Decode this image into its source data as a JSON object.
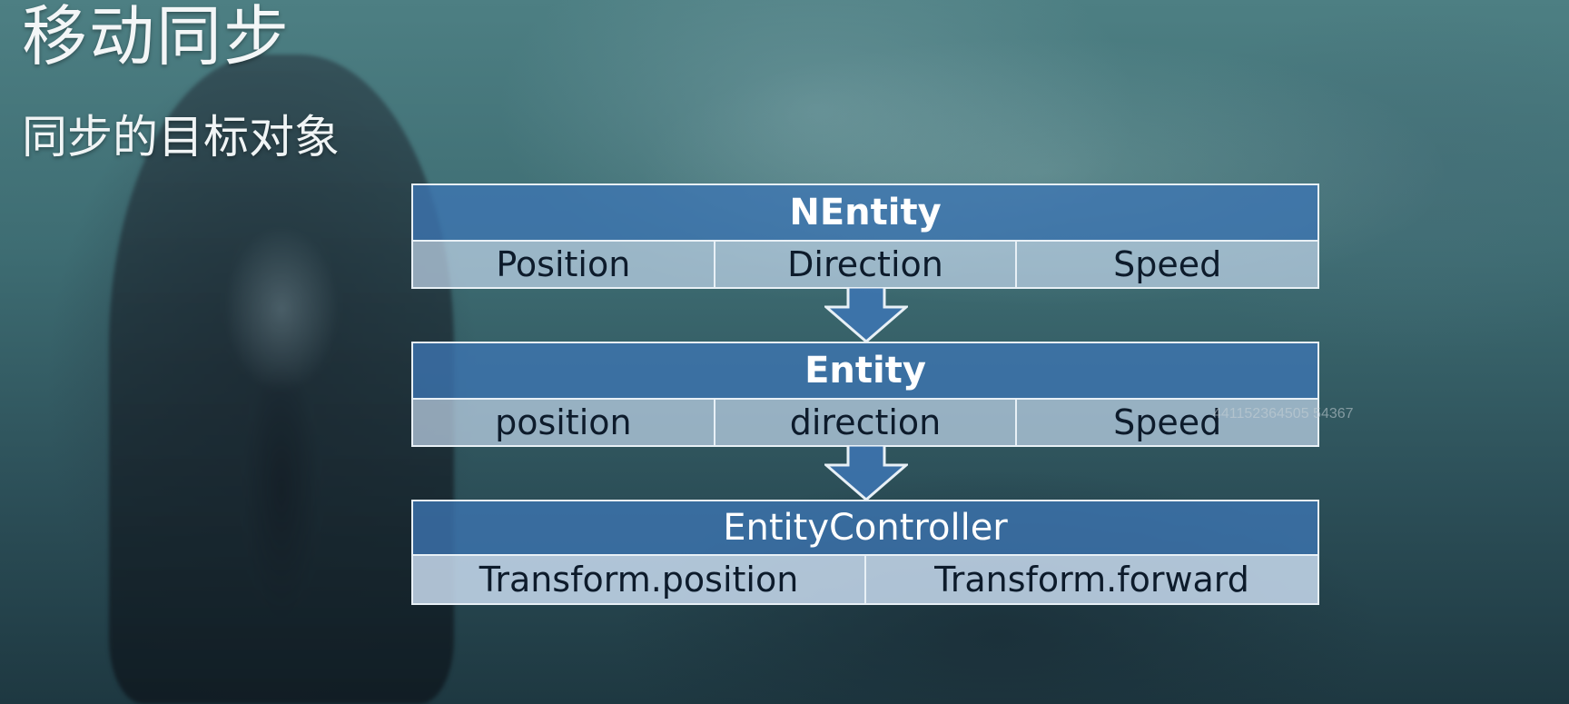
{
  "slide": {
    "title": "移动同步",
    "subtitle": "同步的目标对象"
  },
  "diagram": {
    "boxes": [
      {
        "header": "NEntity",
        "fields": [
          "Position",
          "Direction",
          "Speed"
        ]
      },
      {
        "header": "Entity",
        "fields": [
          "position",
          "direction",
          "Speed"
        ]
      },
      {
        "header": "EntityController",
        "fields": [
          "Transform.position",
          "Transform.forward"
        ]
      }
    ],
    "arrows": [
      "down",
      "down"
    ]
  },
  "watermark": "441152364505 54367",
  "colors": {
    "header_fill": "#3d76b4",
    "cell_fill": "#bed2e8",
    "border": "#e8f0f6",
    "cell_text": "#0d1b2b"
  }
}
